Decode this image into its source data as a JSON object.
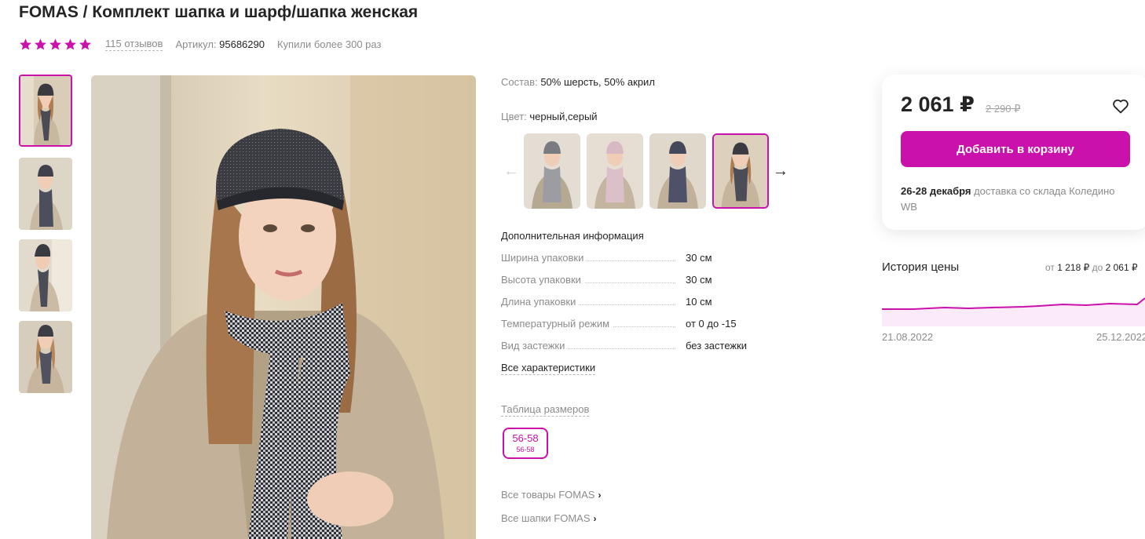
{
  "product": {
    "title": "FOMAS / Комплект шапка и шарф/шапка женская",
    "rating_stars": 5,
    "reviews": "115 отзывов",
    "article_label": "Артикул:",
    "article_value": "95686290",
    "bought": "Купили более 300 раз"
  },
  "details": {
    "composition_label": "Состав:",
    "composition_value": "50% шерсть, 50% акрил",
    "color_label": "Цвет:",
    "color_value": "черный,серый",
    "extra_title": "Дополнительная информация",
    "characteristics": [
      {
        "name": "Ширина упаковки",
        "value": "30 см"
      },
      {
        "name": "Высота упаковки",
        "value": "30 см"
      },
      {
        "name": "Длина упаковки",
        "value": "10 см"
      },
      {
        "name": "Температурный режим",
        "value": "от 0 до -15"
      },
      {
        "name": "Вид застежки",
        "value": "без застежки"
      }
    ],
    "all_characteristics": "Все характеристики",
    "size_table": "Таблица размеров",
    "size_main": "56-58",
    "size_sub": "56-58",
    "brand_links": [
      "Все товары FOMAS",
      "Все шапки FOMAS"
    ]
  },
  "price": {
    "current": "2 061 ₽",
    "old": "2 290 ₽",
    "add_to_cart": "Добавить в корзину",
    "delivery_date": "26-28 декабря",
    "delivery_text": "доставка со склада Коледино WB"
  },
  "history": {
    "title": "История цены",
    "range_from_label": "от",
    "range_from": "1 218 ₽",
    "range_to_label": "до",
    "range_to": "2 061 ₽",
    "date_start": "21.08.2022",
    "date_end": "25.12.2022"
  },
  "colors": {
    "accent": "#cb11ab",
    "text": "#242424",
    "muted": "#8b8b8b"
  },
  "icons": [
    "star-icon",
    "heart-icon",
    "arrow-left-icon",
    "arrow-right-icon",
    "chevron-right-icon"
  ]
}
